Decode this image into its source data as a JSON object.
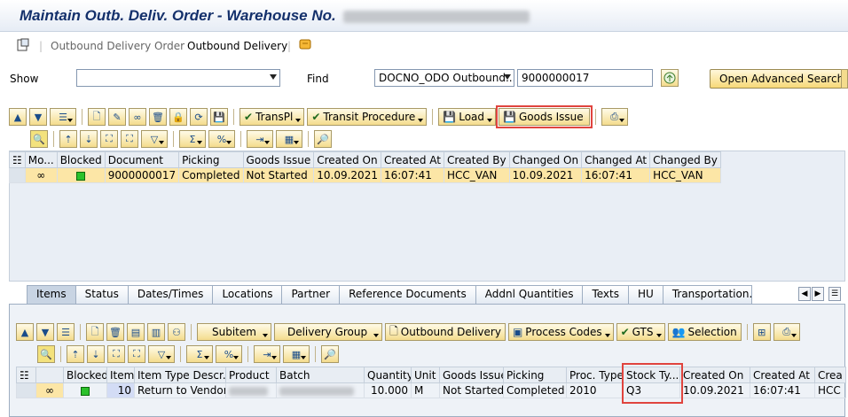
{
  "window": {
    "title": "Maintain Outb. Deliv. Order - Warehouse No."
  },
  "menu": {
    "outbound_delivery_order": "Outbound Delivery Order",
    "outbound_delivery": "Outbound Delivery"
  },
  "search": {
    "show_label": "Show",
    "show_value": "",
    "find_label": "Find",
    "find_field": "DOCNO_ODO Outbound...",
    "find_value": "9000000017",
    "advanced_button": "Open Advanced Search"
  },
  "toolbar_upper": {
    "transpl": "TransPl",
    "transit_procedure": "Transit Procedure",
    "load": "Load",
    "goods_issue": "Goods Issue"
  },
  "upper_table": {
    "columns": [
      "Mo...",
      "Blocked",
      "Document",
      "Picking",
      "Goods Issue",
      "Created On",
      "Created At",
      "Created By",
      "Changed On",
      "Changed At",
      "Changed By"
    ],
    "rows": [
      {
        "document": "9000000017",
        "picking": "Completed",
        "goods_issue": "Not Started",
        "created_on": "10.09.2021",
        "created_at": "16:07:41",
        "created_by": "HCC_VAN",
        "changed_on": "10.09.2021",
        "changed_at": "16:07:41",
        "changed_by": "HCC_VAN"
      }
    ]
  },
  "tabs": [
    "Items",
    "Status",
    "Dates/Times",
    "Locations",
    "Partner",
    "Reference Documents",
    "Addnl Quantities",
    "Texts",
    "HU",
    "Transportation..."
  ],
  "toolbar_lower": {
    "subitem": "Subitem",
    "delivery_group": "Delivery Group",
    "outbound_delivery": "Outbound Delivery",
    "process_codes": "Process Codes",
    "gts": "GTS",
    "selection": "Selection"
  },
  "lower_table": {
    "columns": [
      "Blocked",
      "Item",
      "Item Type Descr.",
      "Product",
      "Batch",
      "Quantity",
      "Unit",
      "Goods Issue",
      "Picking",
      "Proc. Type",
      "Stock Ty...",
      "Created On",
      "Created At",
      "Crea"
    ],
    "rows": [
      {
        "item": "10",
        "item_type": "Return to Vendor",
        "quantity": "10.000",
        "unit": "M",
        "goods_issue": "Not Started",
        "picking": "Completed",
        "proc_type": "2010",
        "stock_type": "Q3",
        "created_on": "10.09.2021",
        "created_at": "16:07:41",
        "created_by": "HCC"
      }
    ]
  }
}
